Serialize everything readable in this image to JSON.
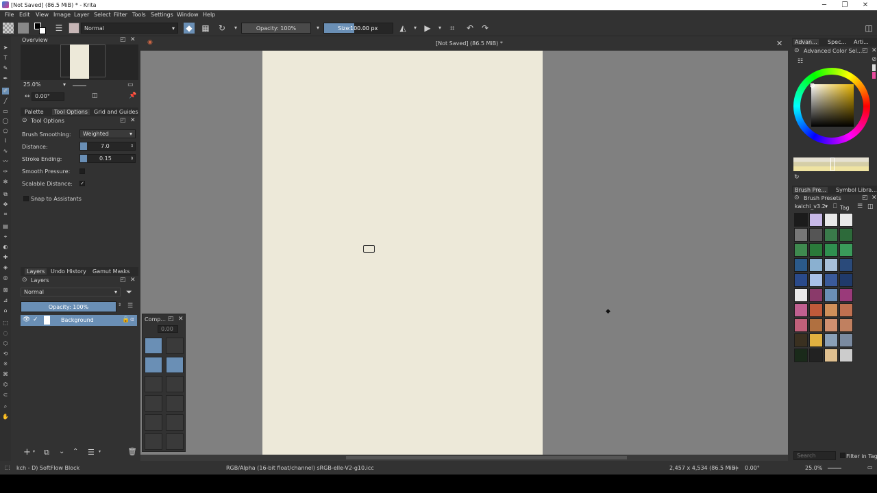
{
  "window": {
    "title": "[Not Saved]  (86.5 MiB) * - Krita",
    "minimize": "─",
    "maximize": "❐",
    "close": "✕"
  },
  "menu": [
    "File",
    "Edit",
    "View",
    "Image",
    "Layer",
    "Select",
    "Filter",
    "Tools",
    "Settings",
    "Window",
    "Help"
  ],
  "toolbar": {
    "blend_mode": "Normal",
    "opacity": "Opacity: 100%",
    "size_label": "Size:",
    "size_value": "100.00 px"
  },
  "overview": {
    "title": "Overview",
    "zoom": "25.0%",
    "rotation": "0.00°"
  },
  "left_tabs": [
    "Palette",
    "Tool Options",
    "Grid and Guides"
  ],
  "tool_options": {
    "title": "Tool Options",
    "brush_smoothing_label": "Brush Smoothing:",
    "brush_smoothing_value": "Weighted",
    "distance_label": "Distance:",
    "distance_value": "7.0",
    "stroke_ending_label": "Stroke Ending:",
    "stroke_ending_value": "0.15",
    "smooth_pressure_label": "Smooth Pressure:",
    "scalable_distance_label": "Scalable Distance:",
    "scalable_distance_check": "✓",
    "snap_label": "Snap to Assistants"
  },
  "layer_tabs": [
    "Layers",
    "Undo History",
    "Gamut Masks"
  ],
  "layers": {
    "title": "Layers",
    "blend": "Normal",
    "opacity": "Opacity:  100%",
    "items": [
      {
        "name": "Background"
      }
    ]
  },
  "compositor": {
    "title": "Comp...",
    "value": "0.00"
  },
  "document": {
    "tab_title": "[Not Saved]  (86.5 MiB) *"
  },
  "right_dock": {
    "tabs": [
      "Advan...",
      "Spec...",
      "Arti..."
    ],
    "color_title": "Advanced Color Sel...",
    "preset_tabs": [
      "Brush Pre...",
      "Symbol Libra..."
    ],
    "presets_title": "Brush Presets",
    "bundle": "kaichi_v3.2",
    "tag": "Tag",
    "search_placeholder": "Search",
    "filter_in_tag": "Filter in Tag"
  },
  "status": {
    "brush": "kch - D) SoftFlow Block",
    "color_space": "RGB/Alpha (16-bit float/channel)  sRGB-elle-V2-g10.icc",
    "dims": "2,457 x 4,534 (86.5 MiB)",
    "rotation": "0.00°",
    "zoom": "25.0%"
  },
  "colors": {
    "canvas_bg": "#808080",
    "paper": "#ede9d9",
    "accent": "#6a8fb5"
  }
}
